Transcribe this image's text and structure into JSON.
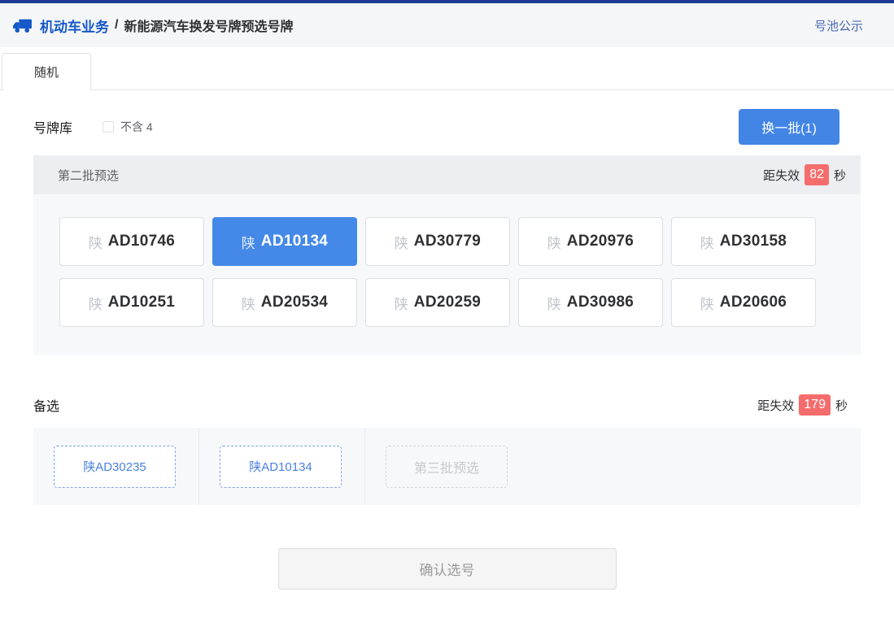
{
  "colors": {
    "topbar_navy": "#1e3c96",
    "brand_blue": "#1659c8",
    "link_blue": "#4a69b0",
    "accent_blue": "#4285e4",
    "selected_blue": "#4489e8",
    "danger_red": "#f56c6c"
  },
  "header": {
    "truck_icon": "truck-icon",
    "breadcrumb_root": "机动车业务",
    "breadcrumb_sep": "/",
    "breadcrumb_current": "新能源汽车换发号牌预选号牌",
    "pool_link": "号池公示"
  },
  "tabs": {
    "random": {
      "label": "随机",
      "active": true
    }
  },
  "pool": {
    "title": "号牌库",
    "checkbox": {
      "label": "不含 4",
      "checked": false
    },
    "refresh_button": "换一批(1)",
    "batch_title": "第二批预选",
    "expire": {
      "prefix": "距失效",
      "seconds": "82",
      "suffix": "秒"
    },
    "plates": [
      {
        "prefix": "陕",
        "number": "AD10746",
        "selected": false
      },
      {
        "prefix": "陕",
        "number": "AD10134",
        "selected": true
      },
      {
        "prefix": "陕",
        "number": "AD30779",
        "selected": false
      },
      {
        "prefix": "陕",
        "number": "AD20976",
        "selected": false
      },
      {
        "prefix": "陕",
        "number": "AD30158",
        "selected": false
      },
      {
        "prefix": "陕",
        "number": "AD10251",
        "selected": false
      },
      {
        "prefix": "陕",
        "number": "AD20534",
        "selected": false
      },
      {
        "prefix": "陕",
        "number": "AD20259",
        "selected": false
      },
      {
        "prefix": "陕",
        "number": "AD30986",
        "selected": false
      },
      {
        "prefix": "陕",
        "number": "AD20606",
        "selected": false
      }
    ]
  },
  "backup": {
    "title": "备选",
    "expire": {
      "prefix": "距失效",
      "seconds": "179",
      "suffix": "秒"
    },
    "slots": [
      {
        "label": "陕AD30235",
        "type": "plate"
      },
      {
        "label": "陕AD10134",
        "type": "plate"
      },
      {
        "label": "第三批预选",
        "type": "placeholder"
      }
    ]
  },
  "confirm_button": "确认选号"
}
